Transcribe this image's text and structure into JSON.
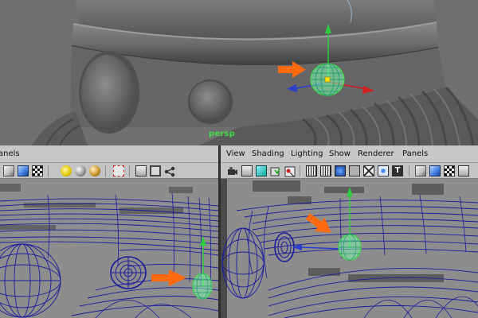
{
  "top_viewport": {
    "camera_label": "persp"
  },
  "right_panel": {
    "menu": [
      "View",
      "Shading",
      "Lighting",
      "Show",
      "Renderer",
      "Panels"
    ]
  },
  "left_panel": {
    "menu_partial": "anels"
  },
  "colors": {
    "viewport_bg": "#6f6f6f",
    "panel_bg": "#8d8d8d",
    "menubar_bg": "#c8c8c8",
    "manip_green": "#3ddc48",
    "manip_highlight": "#7dffb0",
    "axis_y": "#2ecc40",
    "axis_x": "#d21e1e",
    "axis_z": "#2a3fd0",
    "arrow_orange": "#ff6a10",
    "wire_blue": "#1b1e9c",
    "camera_label": "#3ddc48"
  },
  "icons": {
    "left_toolbar": [
      "cube-icon",
      "cube-blue-icon",
      "checker-icon",
      "light-sun-icon",
      "sphere-gray-icon",
      "sphere-gold-icon",
      "select-icon",
      "frame-icon",
      "frame-all-icon",
      "share-icon"
    ],
    "right_toolbar": [
      "camera-icon",
      "film-icon",
      "image-plane-icon",
      "bookmark-icon",
      "grid-icon",
      "wireframe-icon",
      "smooth-shade-icon",
      "default-material-icon",
      "xray-icon",
      "texture-icon",
      "isolate-icon",
      "cube-icon",
      "cube-blue-icon",
      "checker-icon"
    ]
  }
}
